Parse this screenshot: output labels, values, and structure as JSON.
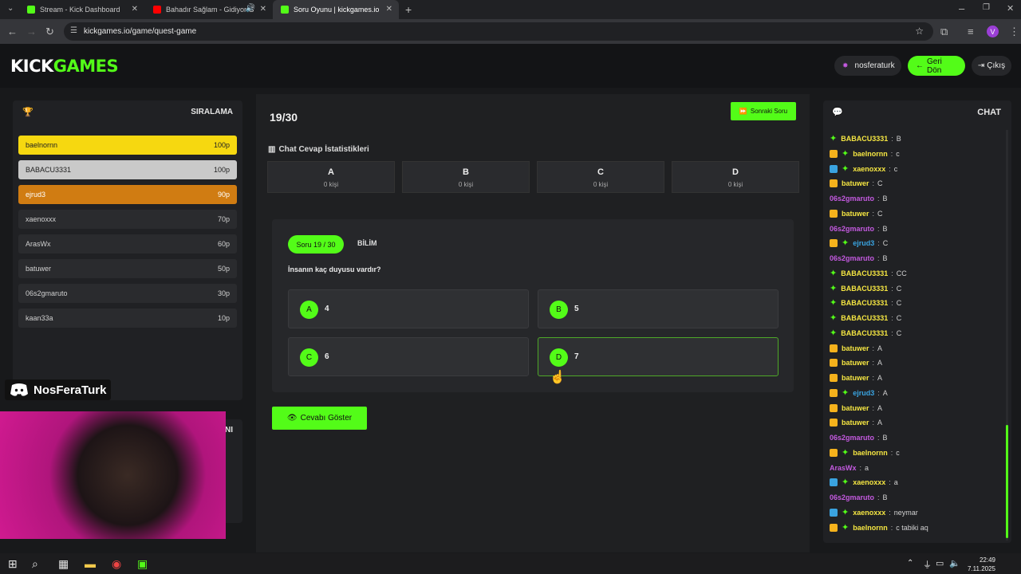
{
  "browser": {
    "tabs": [
      {
        "title": "Stream - Kick Dashboard",
        "color": "#53fc18"
      },
      {
        "title": "Bahadır Sağlam - Gidiyor G",
        "color": "#ff0000"
      },
      {
        "title": "Soru Oyunu | kickgames.io",
        "color": "#53fc18"
      }
    ],
    "url": "kickgames.io/game/quest-game",
    "profile_initial": "V"
  },
  "header": {
    "logo_kick": "KICK",
    "logo_games": "GAMES",
    "username": "nosferaturk",
    "back_label": "Geri Dön",
    "logout_label": "Çıkış"
  },
  "leaderboard": {
    "title": "SIRALAMA",
    "rows": [
      {
        "name": "baelnornn",
        "points": "100p",
        "bg": "#f6d810",
        "fg": "#222222"
      },
      {
        "name": "BABACU3331",
        "points": "100p",
        "bg": "#c9c9c9",
        "fg": "#222222"
      },
      {
        "name": "ejrud3",
        "points": "90p",
        "bg": "#d07c12",
        "fg": "#ffffff"
      },
      {
        "name": "xaenoxxx",
        "points": "70p",
        "bg": "#2a2b2e",
        "fg": "#d0d0d0"
      },
      {
        "name": "ArasWx",
        "points": "60p",
        "bg": "#2a2b2e",
        "fg": "#d0d0d0"
      },
      {
        "name": "batuwer",
        "points": "50p",
        "bg": "#2a2b2e",
        "fg": "#d0d0d0"
      },
      {
        "name": "06s2gmaruto",
        "points": "30p",
        "bg": "#2a2b2e",
        "fg": "#d0d0d0"
      },
      {
        "name": "kaan33a",
        "points": "10p",
        "bg": "#2a2b2e",
        "fg": "#d0d0d0"
      }
    ]
  },
  "overlay": {
    "discord_name": "NosFeraTurk",
    "hidden_fragment": "NI"
  },
  "game": {
    "question_count": "19/30",
    "next_label": "Sonraki Soru",
    "stats_title": "Chat Cevap İstatistikleri",
    "stats": [
      {
        "letter": "A",
        "count": "0 kişi"
      },
      {
        "letter": "B",
        "count": "0 kişi"
      },
      {
        "letter": "C",
        "count": "0 kişi"
      },
      {
        "letter": "D",
        "count": "0 kişi"
      }
    ],
    "badge": "Soru 19 / 30",
    "category": "BİLİM",
    "question": "İnsanın kaç duyusu vardır?",
    "options": [
      {
        "letter": "A",
        "value": "4"
      },
      {
        "letter": "B",
        "value": "5"
      },
      {
        "letter": "C",
        "value": "6"
      },
      {
        "letter": "D",
        "value": "7"
      }
    ],
    "show_answer_label": "Cevabı Göster"
  },
  "chat": {
    "title": "CHAT",
    "messages": [
      {
        "name": "BABACU3331",
        "text": "B",
        "color": "#f5e642",
        "badges": [
          "ver"
        ]
      },
      {
        "name": "baelnornn",
        "text": "c",
        "color": "#f5e642",
        "badges": [
          "sub",
          "ver"
        ]
      },
      {
        "name": "xaenoxxx",
        "text": "c",
        "color": "#f5e642",
        "badges": [
          "mod",
          "ver"
        ]
      },
      {
        "name": "batuwer",
        "text": "C",
        "color": "#f5e642",
        "badges": [
          "sub"
        ]
      },
      {
        "name": "06s2gmaruto",
        "text": "B",
        "color": "#c45ae0",
        "badges": []
      },
      {
        "name": "batuwer",
        "text": "C",
        "color": "#f5e642",
        "badges": [
          "sub"
        ]
      },
      {
        "name": "06s2gmaruto",
        "text": "B",
        "color": "#c45ae0",
        "badges": []
      },
      {
        "name": "ejrud3",
        "text": "C",
        "color": "#3aa3e0",
        "badges": [
          "sub",
          "ver"
        ]
      },
      {
        "name": "06s2gmaruto",
        "text": "B",
        "color": "#c45ae0",
        "badges": []
      },
      {
        "name": "BABACU3331",
        "text": "CC",
        "color": "#f5e642",
        "badges": [
          "ver"
        ]
      },
      {
        "name": "BABACU3331",
        "text": "C",
        "color": "#f5e642",
        "badges": [
          "ver"
        ]
      },
      {
        "name": "BABACU3331",
        "text": "C",
        "color": "#f5e642",
        "badges": [
          "ver"
        ]
      },
      {
        "name": "BABACU3331",
        "text": "C",
        "color": "#f5e642",
        "badges": [
          "ver"
        ]
      },
      {
        "name": "BABACU3331",
        "text": "C",
        "color": "#f5e642",
        "badges": [
          "ver"
        ]
      },
      {
        "name": "batuwer",
        "text": "A",
        "color": "#f5e642",
        "badges": [
          "sub"
        ]
      },
      {
        "name": "batuwer",
        "text": "A",
        "color": "#f5e642",
        "badges": [
          "sub"
        ]
      },
      {
        "name": "batuwer",
        "text": "A",
        "color": "#f5e642",
        "badges": [
          "sub"
        ]
      },
      {
        "name": "ejrud3",
        "text": "A",
        "color": "#3aa3e0",
        "badges": [
          "sub",
          "ver"
        ]
      },
      {
        "name": "batuwer",
        "text": "A",
        "color": "#f5e642",
        "badges": [
          "sub"
        ]
      },
      {
        "name": "batuwer",
        "text": "A",
        "color": "#f5e642",
        "badges": [
          "sub"
        ]
      },
      {
        "name": "06s2gmaruto",
        "text": "B",
        "color": "#c45ae0",
        "badges": []
      },
      {
        "name": "baelnornn",
        "text": "c",
        "color": "#f5e642",
        "badges": [
          "sub",
          "ver"
        ]
      },
      {
        "name": "ArasWx",
        "text": "a",
        "color": "#c45ae0",
        "badges": []
      },
      {
        "name": "xaenoxxx",
        "text": "a",
        "color": "#f5e642",
        "badges": [
          "mod",
          "ver"
        ]
      },
      {
        "name": "06s2gmaruto",
        "text": "B",
        "color": "#c45ae0",
        "badges": []
      },
      {
        "name": "xaenoxxx",
        "text": "neymar",
        "color": "#f5e642",
        "badges": [
          "mod",
          "ver"
        ]
      },
      {
        "name": "baelnornn",
        "text": "c tabiki aq",
        "color": "#f5e642",
        "badges": [
          "sub",
          "ver"
        ]
      }
    ]
  },
  "taskbar": {
    "time": "22:49",
    "date": "7.11.2025"
  }
}
